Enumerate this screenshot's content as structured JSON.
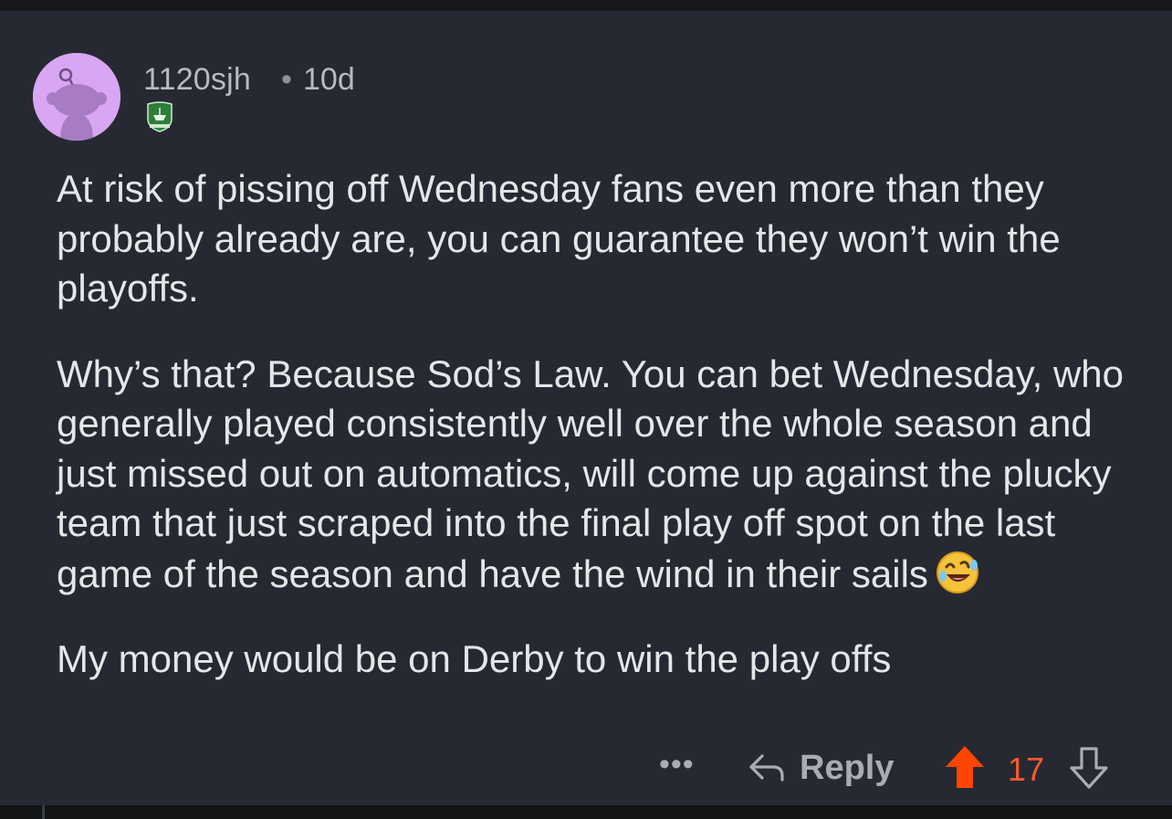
{
  "comment": {
    "author": "1120sjh",
    "separator": "•",
    "age": "10d",
    "avatar_icon": "reddit-snoo-avatar-icon",
    "flair_icon": "club-crest-flair-icon",
    "paragraphs": [
      "At risk of pissing off Wednesday fans even more than they probably already are, you can guarantee they won’t win the playoffs.",
      "Why’s that? Because Sod’s Law. You can bet Wednesday, who generally played consistently well over the whole season and just missed out on automatics, will come up against the plucky team that just scraped into the final play off spot on the last game of the season and have the wind in their sails",
      "My money would be on Derby to win the play offs"
    ],
    "emoji": "rolling-on-floor-laughing-emoji"
  },
  "actions": {
    "more_label": "•••",
    "reply_label": "Reply",
    "score": "17",
    "upvote_color": "#ff4500",
    "score_color": "#ff5a2a"
  }
}
